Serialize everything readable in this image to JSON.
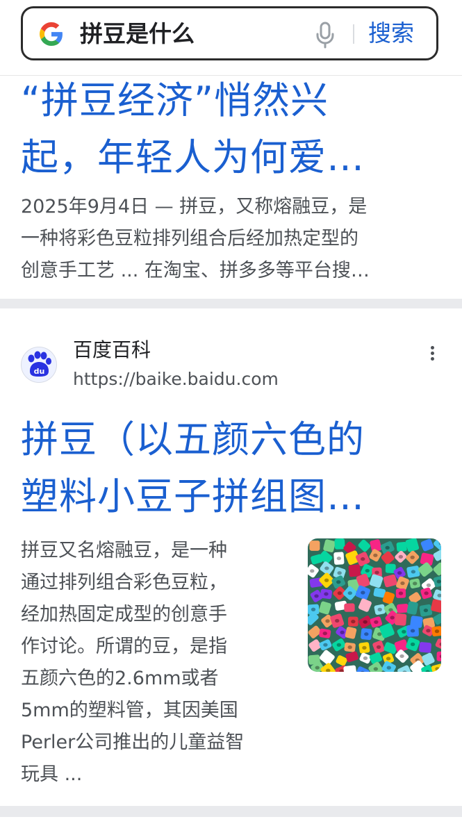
{
  "search": {
    "query": "拼豆是什么",
    "search_label": "搜索",
    "logo_icon": "google-g-icon",
    "mic_icon": "microphone-icon"
  },
  "result1": {
    "title_lines": [
      "“拼豆经济”悄然兴",
      "起，年轻人为何爱…"
    ],
    "snippet_lines": [
      "2025年9月4日 — 拼豆，又称熔融豆，是",
      "一种将彩色豆粒排列组合后经加热定型的",
      "创意手工艺 ... 在淘宝、拼多多等平台搜…"
    ]
  },
  "result2": {
    "site_name": "百度百科",
    "site_url": "https://baike.baidu.com",
    "favicon_icon": "baidu-paw-icon",
    "more_icon": "more-vertical-icon",
    "title_lines": [
      "拼豆（以五颜六色的",
      "塑料小豆子拼组图…"
    ],
    "snippet_lines": [
      "拼豆又名熔融豆，是一种",
      "通过排列组合彩色豆粒，",
      "经加热固定成型的创意手",
      "作讨论。所谓的豆，是指",
      "五颜六色的2.6mm或者",
      "5mm的塑料管，其因美国",
      "Perler公司推出的儿童益智",
      "玩具 ..."
    ],
    "thumbnail": "colorful-fuse-beads-image"
  },
  "colors": {
    "link": "#1a5fd0",
    "text": "#202124",
    "muted": "#4d5156",
    "separator": "#e9eaed"
  }
}
